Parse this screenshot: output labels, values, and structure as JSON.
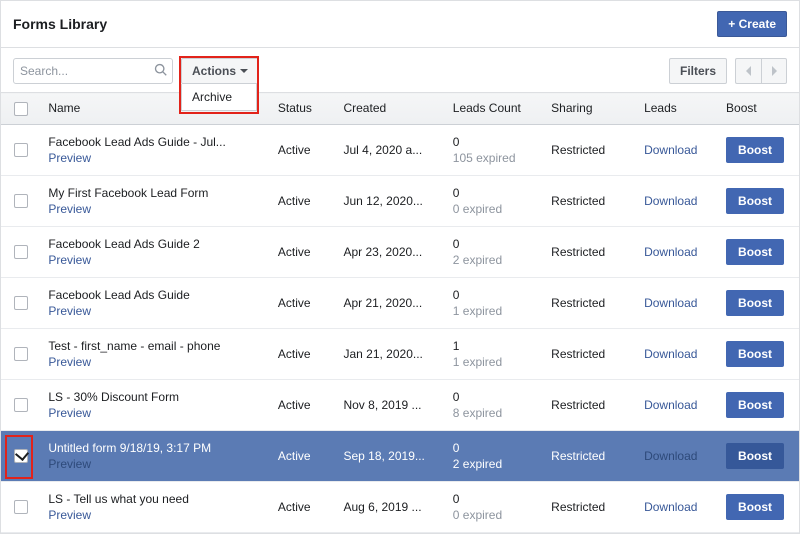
{
  "header": {
    "title": "Forms Library",
    "create_label": "+ Create"
  },
  "toolbar": {
    "search_placeholder": "Search...",
    "actions_label": "Actions",
    "dropdown_item": "Archive",
    "filters_label": "Filters"
  },
  "columns": {
    "name": "Name",
    "status": "Status",
    "created": "Created",
    "leads_count": "Leads Count",
    "sharing": "Sharing",
    "leads": "Leads",
    "boost": "Boost"
  },
  "common": {
    "preview": "Preview",
    "download": "Download",
    "boost": "Boost"
  },
  "rows": [
    {
      "name": "Facebook Lead Ads Guide - Jul...",
      "status": "Active",
      "created": "Jul 4, 2020 a...",
      "count": "0",
      "expired": "105 expired",
      "sharing": "Restricted",
      "selected": false
    },
    {
      "name": "My First Facebook Lead Form",
      "status": "Active",
      "created": "Jun 12, 2020...",
      "count": "0",
      "expired": "0 expired",
      "sharing": "Restricted",
      "selected": false
    },
    {
      "name": "Facebook Lead Ads Guide 2",
      "status": "Active",
      "created": "Apr 23, 2020...",
      "count": "0",
      "expired": "2 expired",
      "sharing": "Restricted",
      "selected": false
    },
    {
      "name": "Facebook Lead Ads Guide",
      "status": "Active",
      "created": "Apr 21, 2020...",
      "count": "0",
      "expired": "1 expired",
      "sharing": "Restricted",
      "selected": false
    },
    {
      "name": "Test - first_name - email - phone",
      "status": "Active",
      "created": "Jan 21, 2020...",
      "count": "1",
      "expired": "1 expired",
      "sharing": "Restricted",
      "selected": false
    },
    {
      "name": "LS - 30% Discount Form",
      "status": "Active",
      "created": "Nov 8, 2019 ...",
      "count": "0",
      "expired": "8 expired",
      "sharing": "Restricted",
      "selected": false
    },
    {
      "name": "Untitled form 9/18/19, 3:17 PM",
      "status": "Active",
      "created": "Sep 18, 2019...",
      "count": "0",
      "expired": "2 expired",
      "sharing": "Restricted",
      "selected": true
    },
    {
      "name": "LS - Tell us what you need",
      "status": "Active",
      "created": "Aug 6, 2019 ...",
      "count": "0",
      "expired": "0 expired",
      "sharing": "Restricted",
      "selected": false
    }
  ]
}
